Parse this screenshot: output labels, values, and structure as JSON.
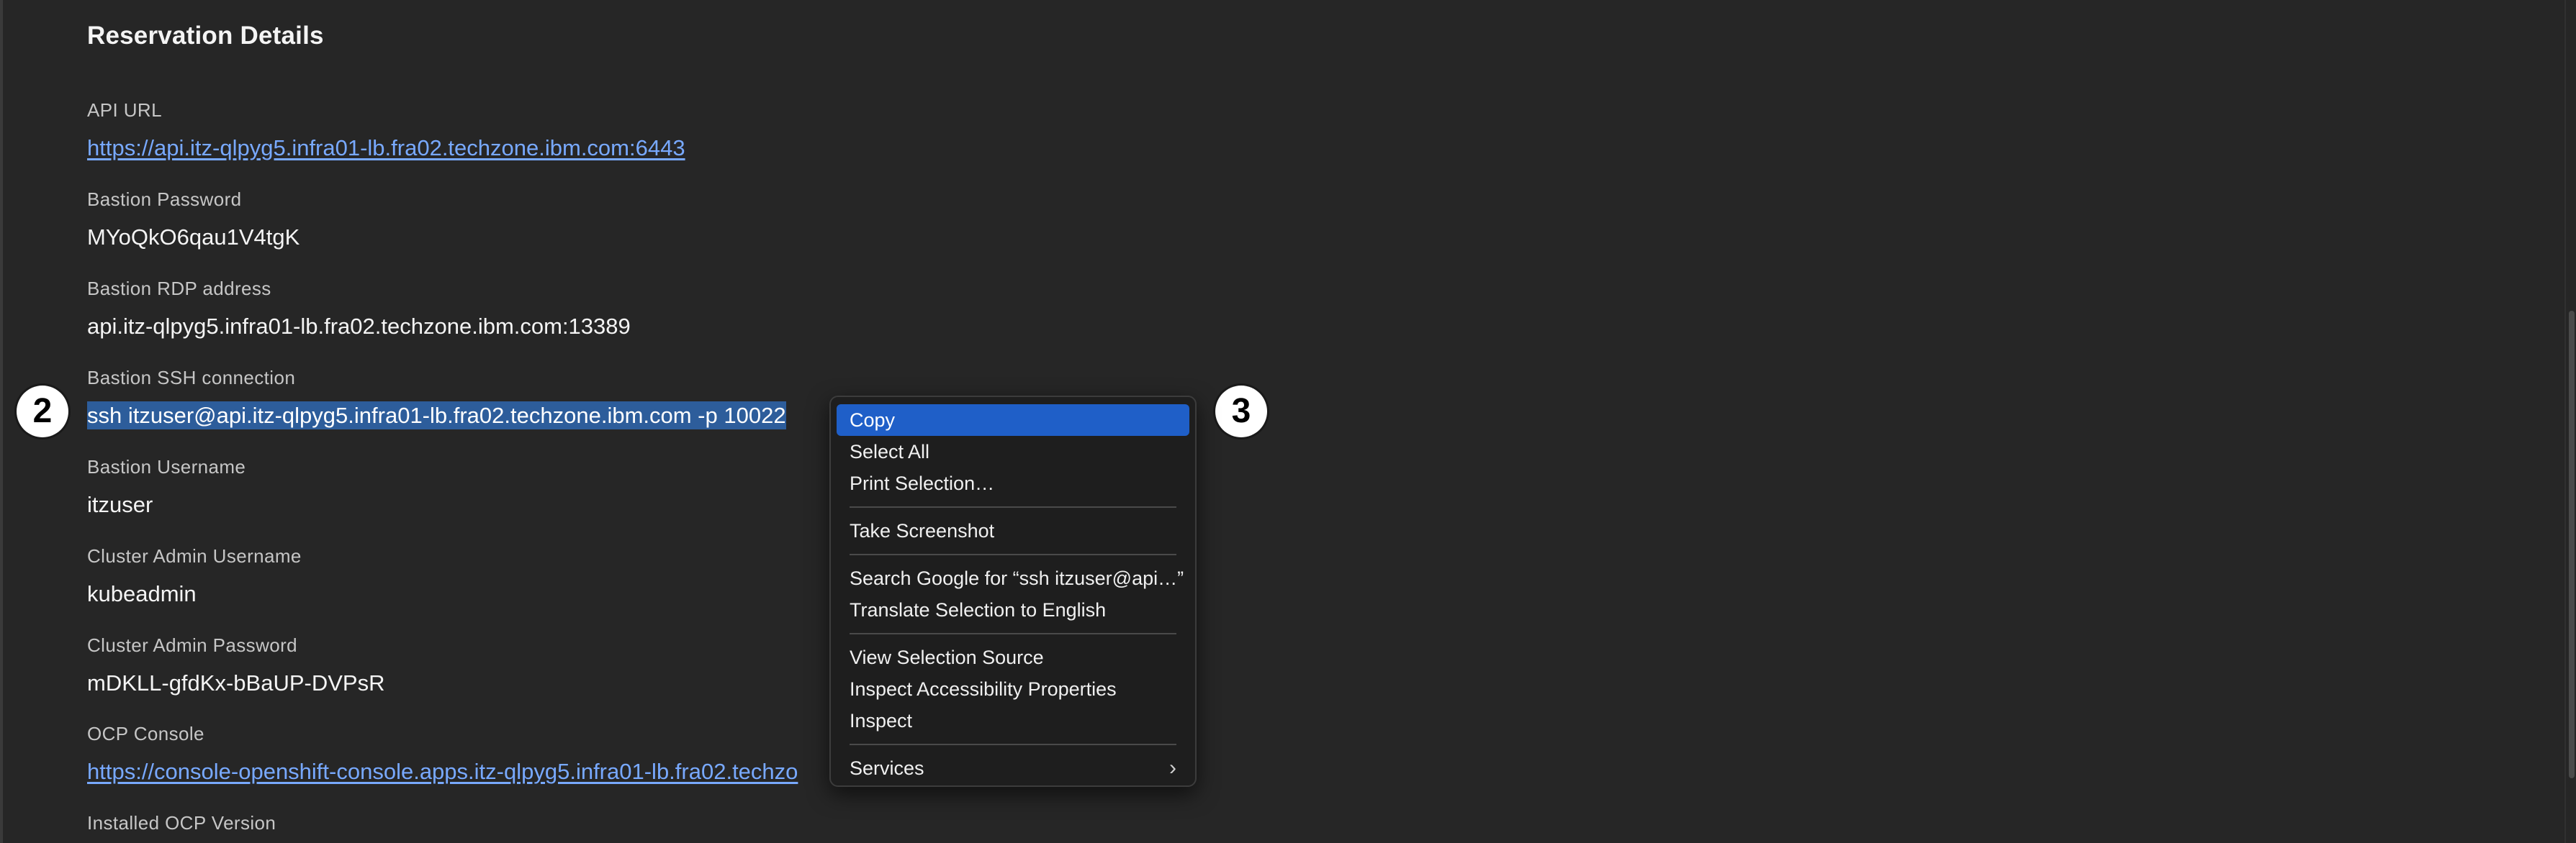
{
  "page": {
    "title": "Reservation Details"
  },
  "fields": [
    {
      "label": "API URL",
      "value": "https://api.itz-qlpyg5.infra01-lb.fra02.techzone.ibm.com:6443",
      "is_link": true
    },
    {
      "label": "Bastion Password",
      "value": "MYoQkO6qau1V4tgK",
      "is_link": false
    },
    {
      "label": "Bastion RDP address",
      "value": "api.itz-qlpyg5.infra01-lb.fra02.techzone.ibm.com:13389",
      "is_link": false
    },
    {
      "label": "Bastion SSH connection",
      "value": "ssh itzuser@api.itz-qlpyg5.infra01-lb.fra02.techzone.ibm.com -p 10022",
      "is_link": false,
      "selected": true
    },
    {
      "label": "Bastion Username",
      "value": "itzuser",
      "is_link": false
    },
    {
      "label": "Cluster Admin Username",
      "value": "kubeadmin",
      "is_link": false
    },
    {
      "label": "Cluster Admin Password",
      "value": "mDKLL-gfdKx-bBaUP-DVPsR",
      "is_link": false
    },
    {
      "label": "OCP Console",
      "value": "https://console-openshift-console.apps.itz-qlpyg5.infra01-lb.fra02.techzo",
      "is_link": true
    },
    {
      "label": "Installed OCP Version",
      "value": "",
      "is_link": false
    }
  ],
  "badges": {
    "selection_badge": "2",
    "menu_badge": "3"
  },
  "context_menu": {
    "items": {
      "copy": "Copy",
      "select_all": "Select All",
      "print_selection": "Print Selection…",
      "take_screenshot": "Take Screenshot",
      "search_google": "Search Google for “ssh itzuser@api…”",
      "translate": "Translate Selection to English",
      "view_source": "View Selection Source",
      "inspect_accessibility": "Inspect Accessibility Properties",
      "inspect": "Inspect",
      "services": "Services"
    },
    "highlighted": "copy"
  },
  "colors": {
    "background": "#262626",
    "link": "#78a9ff",
    "selection": "#2d5d9b",
    "menu_highlight": "#1f5fc8"
  }
}
